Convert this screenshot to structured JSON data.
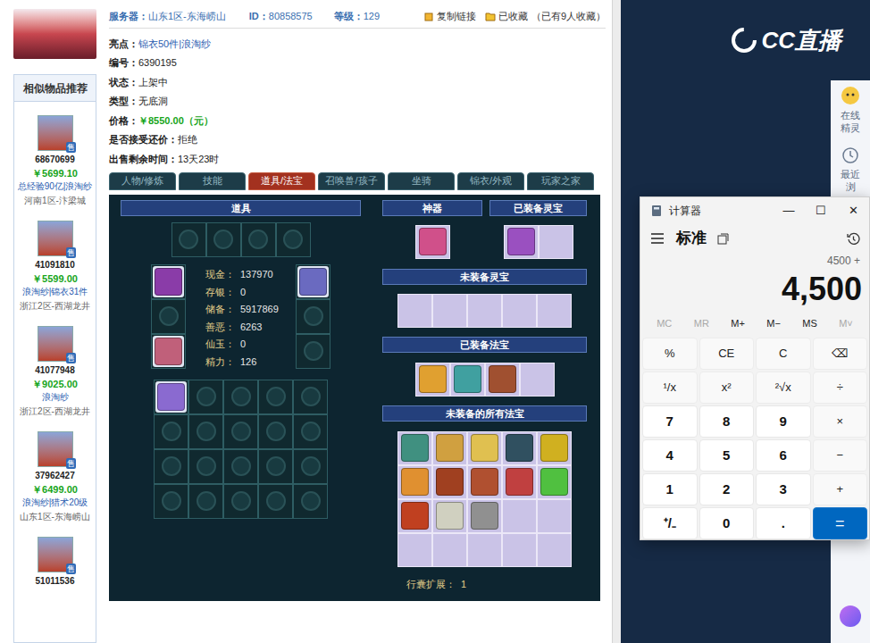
{
  "header": {
    "server_label": "服务器：",
    "server": "山东1区-东海崂山",
    "id_label": "ID：",
    "id": "80858575",
    "level_label": "等级：",
    "level": "129",
    "copy_link": "复制链接",
    "favorite": "已收藏",
    "favorite_count": "（已有9人收藏）"
  },
  "details": [
    {
      "label": "亮点：",
      "value": "锦衣50件|浪淘纱",
      "kind": "link"
    },
    {
      "label": "编号：",
      "value": "6390195",
      "kind": "plain"
    },
    {
      "label": "状态：",
      "value": "上架中",
      "kind": "plain"
    },
    {
      "label": "类型：",
      "value": "无底洞",
      "kind": "plain"
    },
    {
      "label": "价格：",
      "value": "￥8550.00（元）",
      "kind": "price"
    },
    {
      "label": "是否接受还价：",
      "value": "拒绝",
      "kind": "plain"
    },
    {
      "label": "出售剩余时间：",
      "value": "13天23时",
      "kind": "plain"
    }
  ],
  "similar": {
    "title": "相似物品推荐",
    "items": [
      {
        "id": "68670699",
        "badge": "售",
        "price": "￥5699.10",
        "tags": "总经验90亿|浪淘纱",
        "server": "河南1区-汴梁城"
      },
      {
        "id": "41091810",
        "badge": "售",
        "price": "￥5599.00",
        "tags": "浪淘纱|锦衣31件",
        "server": "浙江2区-西湖龙井"
      },
      {
        "id": "41077948",
        "badge": "售",
        "price": "￥9025.00",
        "tags": "浪淘纱",
        "server": "浙江2区-西湖龙井"
      },
      {
        "id": "37962427",
        "badge": "售",
        "price": "￥6499.00",
        "tags": "浪淘纱|猎术20级",
        "server": "山东1区-东海崂山"
      },
      {
        "id": "51011536",
        "badge": "售"
      }
    ]
  },
  "tabs": [
    {
      "label": "人物/修炼",
      "selected": false
    },
    {
      "label": "技能",
      "selected": false
    },
    {
      "label": "道具/法宝",
      "selected": true
    },
    {
      "label": "召唤兽/孩子",
      "selected": false
    },
    {
      "label": "坐骑",
      "selected": false
    },
    {
      "label": "锦衣/外观",
      "selected": false
    },
    {
      "label": "玩家之家",
      "selected": false
    }
  ],
  "panel": {
    "items_title": "道具",
    "top_slots": [
      {
        "filled": false
      },
      {
        "filled": false
      },
      {
        "filled": false
      },
      {
        "filled": false
      }
    ],
    "left_slots": [
      {
        "filled": true,
        "color": "#8a3ca8"
      },
      {
        "filled": false
      },
      {
        "filled": true,
        "color": "#c0607a"
      }
    ],
    "right_slots": [
      {
        "filled": true,
        "color": "#6a6ac0"
      },
      {
        "filled": false
      },
      {
        "filled": false
      }
    ],
    "stats": [
      {
        "label": "现金：",
        "value": "137970"
      },
      {
        "label": "存银：",
        "value": "0"
      },
      {
        "label": "储备：",
        "value": "5917869"
      },
      {
        "label": "善恶：",
        "value": "6263"
      },
      {
        "label": "仙玉：",
        "value": "0"
      },
      {
        "label": "精力：",
        "value": "126"
      }
    ],
    "inventory": [
      {
        "filled": true,
        "color": "#8a6ad0"
      },
      {
        "filled": false
      },
      {
        "filled": false
      },
      {
        "filled": false
      },
      {
        "filled": false
      },
      {
        "filled": false
      },
      {
        "filled": false
      },
      {
        "filled": false
      },
      {
        "filled": false
      },
      {
        "filled": false
      },
      {
        "filled": false
      },
      {
        "filled": false
      },
      {
        "filled": false
      },
      {
        "filled": false
      },
      {
        "filled": false
      },
      {
        "filled": false
      },
      {
        "filled": false
      },
      {
        "filled": false
      },
      {
        "filled": false
      },
      {
        "filled": false
      }
    ],
    "artifact_title": "神器",
    "artifact": [
      {
        "filled": true,
        "color": "#d0508a"
      }
    ],
    "equipped_lingbao_title": "已装备灵宝",
    "equipped_lingbao": [
      {
        "filled": true,
        "color": "#9a50c0"
      },
      {
        "filled": false
      }
    ],
    "unequipped_lingbao_title": "未装备灵宝",
    "unequipped_lingbao": [
      {
        "filled": false
      },
      {
        "filled": false
      },
      {
        "filled": false
      },
      {
        "filled": false
      },
      {
        "filled": false
      }
    ],
    "equipped_fabao_title": "已装备法宝",
    "equipped_fabao": [
      {
        "filled": true,
        "color": "#e0a030"
      },
      {
        "filled": true,
        "color": "#40a0a0"
      },
      {
        "filled": true,
        "color": "#a05030"
      },
      {
        "filled": false
      }
    ],
    "all_fabao_title": "未装备的所有法宝",
    "all_fabao": [
      {
        "filled": true,
        "color": "#409080"
      },
      {
        "filled": true,
        "color": "#d0a040"
      },
      {
        "filled": true,
        "color": "#e0c050"
      },
      {
        "filled": true,
        "color": "#305060"
      },
      {
        "filled": true,
        "color": "#d0b020"
      },
      {
        "filled": true,
        "color": "#e09030"
      },
      {
        "filled": true,
        "color": "#a04020"
      },
      {
        "filled": true,
        "color": "#b05030"
      },
      {
        "filled": true,
        "color": "#c04040"
      },
      {
        "filled": true,
        "color": "#50c040"
      },
      {
        "filled": true,
        "color": "#c04020"
      },
      {
        "filled": true,
        "color": "#d0d0c0"
      },
      {
        "filled": true,
        "color": "#909090"
      },
      {
        "filled": false
      },
      {
        "filled": false
      },
      {
        "filled": false
      },
      {
        "filled": false
      },
      {
        "filled": false
      },
      {
        "filled": false
      },
      {
        "filled": false
      }
    ],
    "expansion": "行囊扩展：  1"
  },
  "cc": {
    "logo": "CC直播",
    "side": [
      {
        "label": "在线精灵"
      },
      {
        "label": "最近浏"
      }
    ]
  },
  "calculator": {
    "title": "计算器",
    "controls": [
      "—",
      "☐",
      "✕"
    ],
    "mode": "标准",
    "expression": "4500 +",
    "display": "4,500",
    "memory": [
      {
        "label": "MC",
        "disabled": true
      },
      {
        "label": "MR",
        "disabled": true
      },
      {
        "label": "M+",
        "disabled": false
      },
      {
        "label": "M−",
        "disabled": false
      },
      {
        "label": "MS",
        "disabled": false
      },
      {
        "label": "M˅",
        "disabled": true
      }
    ],
    "keys": [
      {
        "label": "%",
        "kind": "op"
      },
      {
        "label": "CE",
        "kind": "op"
      },
      {
        "label": "C",
        "kind": "op"
      },
      {
        "label": "⌫",
        "kind": "op"
      },
      {
        "label": "¹/x",
        "kind": "op"
      },
      {
        "label": "x²",
        "kind": "op"
      },
      {
        "label": "²√x",
        "kind": "op"
      },
      {
        "label": "÷",
        "kind": "op"
      },
      {
        "label": "7",
        "kind": "digit"
      },
      {
        "label": "8",
        "kind": "digit"
      },
      {
        "label": "9",
        "kind": "digit"
      },
      {
        "label": "×",
        "kind": "op"
      },
      {
        "label": "4",
        "kind": "digit"
      },
      {
        "label": "5",
        "kind": "digit"
      },
      {
        "label": "6",
        "kind": "digit"
      },
      {
        "label": "−",
        "kind": "op"
      },
      {
        "label": "1",
        "kind": "digit"
      },
      {
        "label": "2",
        "kind": "digit"
      },
      {
        "label": "3",
        "kind": "digit"
      },
      {
        "label": "+",
        "kind": "op"
      },
      {
        "label": "⁺/₋",
        "kind": "digit"
      },
      {
        "label": "0",
        "kind": "digit"
      },
      {
        "label": ".",
        "kind": "digit"
      },
      {
        "label": "=",
        "kind": "equals"
      }
    ]
  }
}
